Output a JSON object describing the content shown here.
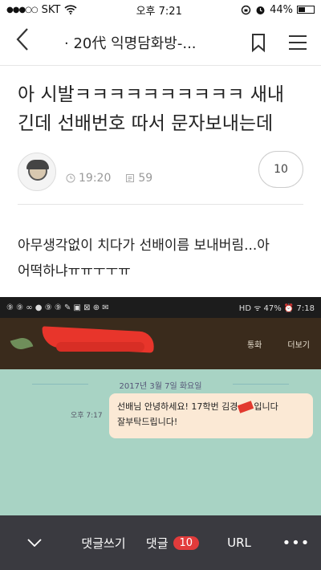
{
  "status_bar": {
    "carrier": "SKT",
    "signal": "●●●○○",
    "time": "오후 7:21",
    "battery": "44%",
    "battery_level": 0.44
  },
  "nav": {
    "back_icon": "chevron-left-icon",
    "title": "· 20代 익명담화방-...",
    "bookmark_icon": "bookmark-icon",
    "menu_icon": "hamburger-icon"
  },
  "post": {
    "title_line1": "아 시발ㅋㅋㅋㅋㅋㅋㅋㅋㅋㅋ 새내",
    "title_line2": "긴데 선배번호 따서 문자보내는데",
    "time": "19:20",
    "views": "59",
    "comment_count": "10",
    "body_line1": "아무생각없이 치다가 선배이름 보내버림...아",
    "body_line2": "어떡하냐ㅠㅠㅜㅜㅠ"
  },
  "screenshot": {
    "status_left": "⑨ ⑨ ∞ ● ⑨ ⑨ ✎ ▣ ⊠ ⊕ ✉",
    "status_right": "HD ᯤ 47% ⏰ 7:18",
    "action_call": "통화",
    "action_more": "더보기",
    "date": "2017년 3월 7일 화요일",
    "msg_time": "오후 7:17",
    "msg_line1a": "선배님 안녕하세요! 17학번 김경",
    "msg_line1b": "입니다",
    "msg_line2": "잘부탁드립니다!"
  },
  "bottom_bar": {
    "write_label": "댓글쓰기",
    "comments_label": "댓글",
    "comments_count": "10",
    "url_label": "URL",
    "more_label": "•••"
  }
}
